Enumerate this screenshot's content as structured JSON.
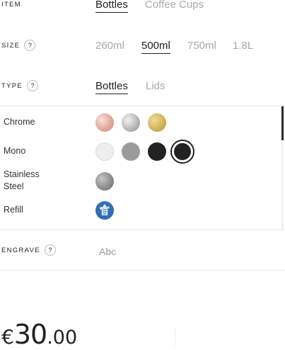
{
  "item": {
    "label": "ITEM",
    "options": [
      "Bottles",
      "Coffee Cups"
    ]
  },
  "size": {
    "label": "SIZE",
    "help": "?",
    "options": [
      "260ml",
      "500ml",
      "750ml",
      "1.8L"
    ]
  },
  "type": {
    "label": "TYPE",
    "help": "?",
    "options": [
      "Bottles",
      "Lids"
    ]
  },
  "finishes": {
    "chrome_label": "Chrome",
    "mono_label": "Mono",
    "stainless_label": "Stainless\nSteel",
    "refill_label": "Refill",
    "chrome_colors": [
      "#e3a89e",
      "#b9b9b9",
      "#d4b35a"
    ],
    "mono_colors": [
      "#eeeeee",
      "#9b9b9b",
      "#222222",
      "#222222"
    ],
    "stainless_color": "#8a8a8a",
    "refill_color": "#2f6fb3"
  },
  "engrave": {
    "label": "ENGRAVE",
    "help": "?",
    "placeholder": "Abc"
  },
  "price": {
    "currency": "€",
    "whole": "30",
    "cents": ".00"
  }
}
